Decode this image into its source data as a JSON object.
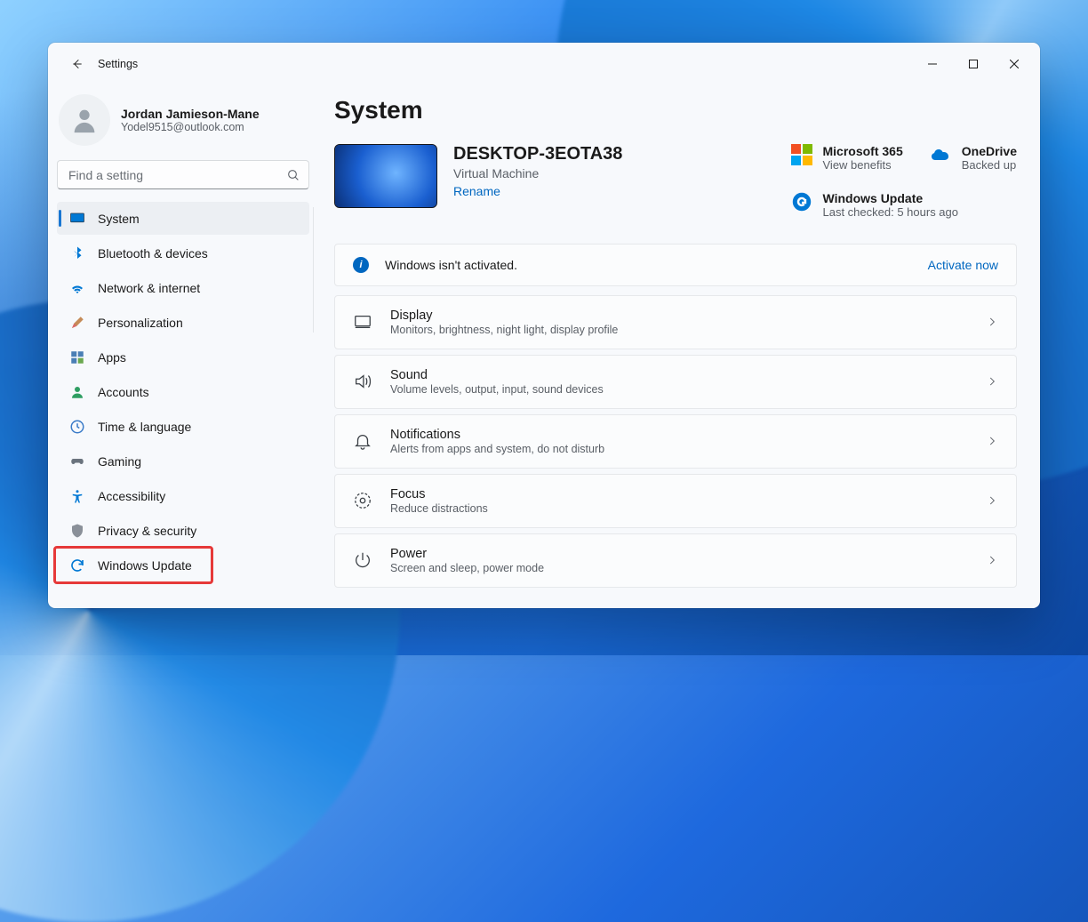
{
  "window": {
    "title": "Settings"
  },
  "user": {
    "name": "Jordan Jamieson-Mane",
    "email": "Yodel9515@outlook.com"
  },
  "search": {
    "placeholder": "Find a setting"
  },
  "nav": [
    {
      "label": "System",
      "icon": "system",
      "active": true
    },
    {
      "label": "Bluetooth & devices",
      "icon": "bluetooth"
    },
    {
      "label": "Network & internet",
      "icon": "wifi"
    },
    {
      "label": "Personalization",
      "icon": "brush"
    },
    {
      "label": "Apps",
      "icon": "apps"
    },
    {
      "label": "Accounts",
      "icon": "person"
    },
    {
      "label": "Time & language",
      "icon": "clock"
    },
    {
      "label": "Gaming",
      "icon": "gamepad"
    },
    {
      "label": "Accessibility",
      "icon": "accessibility"
    },
    {
      "label": "Privacy & security",
      "icon": "shield"
    },
    {
      "label": "Windows Update",
      "icon": "update",
      "highlighted": true
    }
  ],
  "page": {
    "title": "System"
  },
  "pc": {
    "name": "DESKTOP-3EOTA38",
    "sub": "Virtual Machine",
    "rename": "Rename"
  },
  "shortcuts": {
    "ms365": {
      "title": "Microsoft 365",
      "sub": "View benefits"
    },
    "onedrive": {
      "title": "OneDrive",
      "sub": "Backed up"
    },
    "update": {
      "title": "Windows Update",
      "sub": "Last checked: 5 hours ago"
    }
  },
  "banner": {
    "text": "Windows isn't activated.",
    "action": "Activate now"
  },
  "cards": [
    {
      "title": "Display",
      "sub": "Monitors, brightness, night light, display profile",
      "icon": "display"
    },
    {
      "title": "Sound",
      "sub": "Volume levels, output, input, sound devices",
      "icon": "sound"
    },
    {
      "title": "Notifications",
      "sub": "Alerts from apps and system, do not disturb",
      "icon": "bell"
    },
    {
      "title": "Focus",
      "sub": "Reduce distractions",
      "icon": "focus"
    },
    {
      "title": "Power",
      "sub": "Screen and sleep, power mode",
      "icon": "power"
    }
  ]
}
